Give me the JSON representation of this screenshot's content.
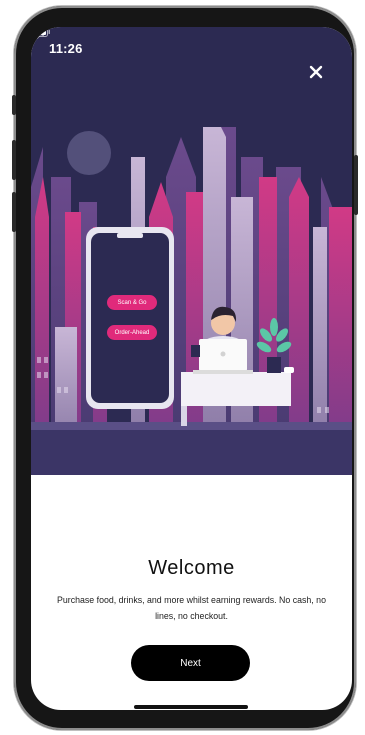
{
  "status_bar": {
    "time": "11:26"
  },
  "hero": {
    "phone_buttons": [
      "Scan & Go",
      "Order-Ahead"
    ],
    "colors": {
      "sky": "#2c2a52",
      "accent": "#e02a7b"
    }
  },
  "welcome": {
    "title": "Welcome",
    "body": "Purchase food, drinks, and more whilst earning rewards. No cash, no lines, no checkout.",
    "next_label": "Next"
  }
}
